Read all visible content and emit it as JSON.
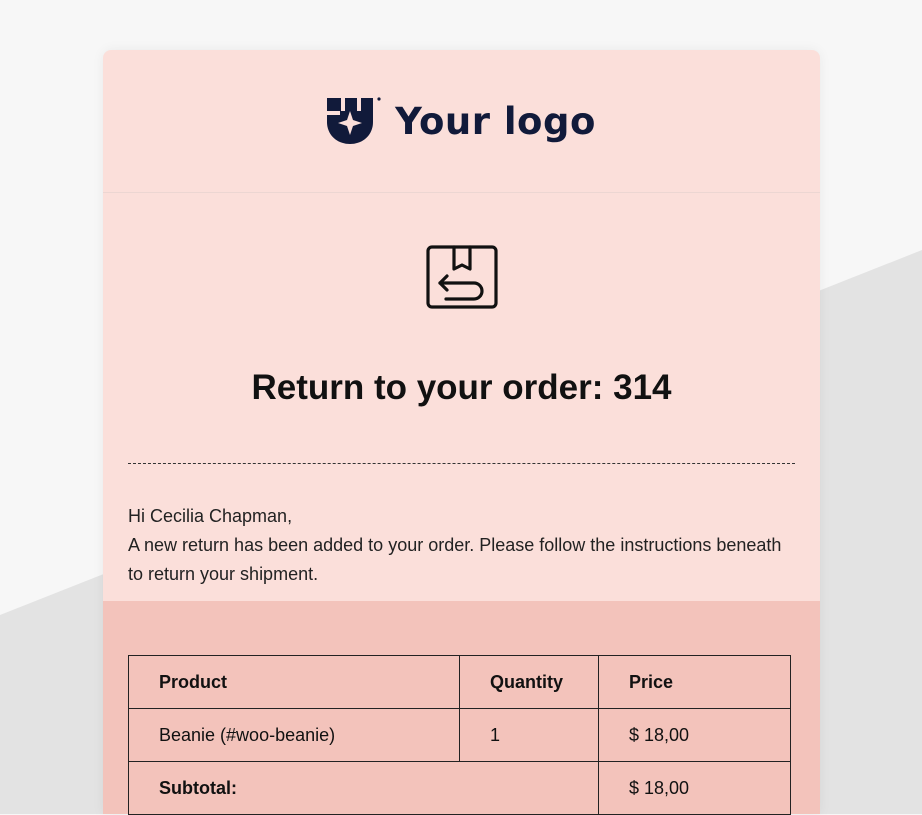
{
  "header": {
    "logo_text": "Your logo"
  },
  "title": "Return to your order: 314",
  "greeting": "Hi Cecilia Chapman,",
  "message": "A new return has been added to your order. Please follow the instructions beneath to return your shipment.",
  "table": {
    "headers": [
      "Product",
      "Quantity",
      "Price"
    ],
    "rows": [
      {
        "product": "Beanie (#woo-beanie)",
        "quantity": "1",
        "price": "$ 18,00"
      }
    ],
    "subtotal_label": "Subtotal:",
    "subtotal_value": "$ 18,00"
  },
  "colors": {
    "card": "#fbdfda",
    "table_section": "#f3c3bb",
    "logo": "#111a3a"
  }
}
